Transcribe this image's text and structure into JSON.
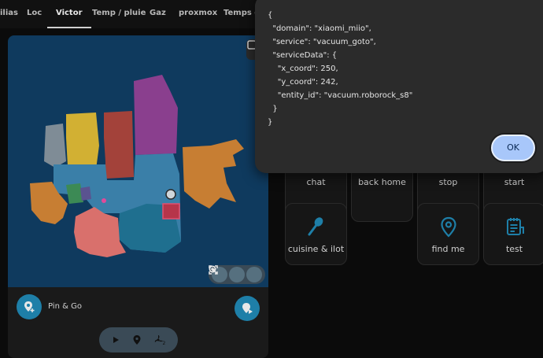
{
  "tabs": [
    {
      "label": "ilias"
    },
    {
      "label": "Loc"
    },
    {
      "label": "Victor"
    },
    {
      "label": "Temp / pluie"
    },
    {
      "label": "Gaz"
    },
    {
      "label": "proxmox"
    },
    {
      "label": "Temps d'u"
    }
  ],
  "active_tab": "Victor",
  "map_card": {
    "pin_go_label": "Pin & Go",
    "icons": {
      "corner": "edit-icon",
      "zoom_fit": "fit-screen-icon",
      "zoom_out": "zoom-out-icon",
      "zoom_in": "zoom-in-icon",
      "pin_add": "add-location-icon",
      "play": "play-location-icon",
      "mode_play": "play-icon",
      "mode_pin": "location-pin-icon",
      "mode_fan": "fan-icon"
    },
    "colors": {
      "map_bg": "#0f3a5e",
      "fab": "#1e7fa8"
    }
  },
  "grid_buttons": [
    {
      "label": "chat"
    },
    {
      "label": "back home"
    },
    {
      "label": "stop"
    },
    {
      "label": "start"
    },
    {
      "label": "cuisine & ilot",
      "icon": "spoon-icon"
    },
    {
      "label": "find me",
      "icon": "location-pin-icon"
    },
    {
      "label": "test",
      "icon": "notes-icon"
    }
  ],
  "dialog": {
    "json_lines": [
      "{",
      "  \"domain\": \"xiaomi_miio\",",
      "  \"service\": \"vacuum_goto\",",
      "  \"serviceData\": {",
      "    \"x_coord\": 250,",
      "    \"y_coord\": 242,",
      "    \"entity_id\": \"vacuum.roborock_s8\"",
      "  }",
      "}"
    ],
    "ok_label": "OK"
  }
}
